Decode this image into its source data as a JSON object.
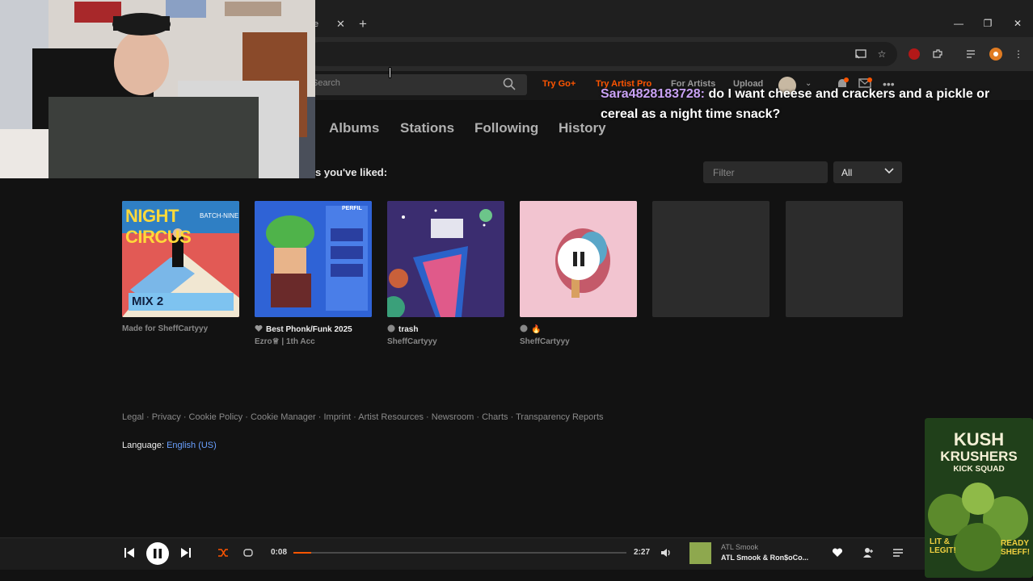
{
  "header": {
    "search_placeholder": "Search",
    "try_go": "Try Go+",
    "try_artist_pro": "Try Artist Pro",
    "for_artists": "For Artists",
    "upload": "Upload"
  },
  "chat": {
    "username": "Sara4828183728:",
    "message": " do I want cheese and crackers and a pickle or cereal as a night time snack?"
  },
  "library_tabs": [
    "Albums",
    "Stations",
    "Following",
    "History"
  ],
  "liked_heading": "s you've liked:",
  "filter": {
    "placeholder": "Filter",
    "select_value": "All"
  },
  "tiles": [
    {
      "art_text": "NIGHT CIRCUS",
      "art_sub": "BATCH-NINE",
      "art_label": "MIX 2",
      "title": "Made for SheffCartyyy",
      "subtitle": ""
    },
    {
      "art_text": "PERFIL",
      "title": "Best Phonk/Funk 2025",
      "subtitle": "Ezro♕ | 1th Acc"
    },
    {
      "title": "trash",
      "subtitle": "SheffCartyyy"
    },
    {
      "title": "🔥",
      "subtitle": "SheffCartyyy"
    }
  ],
  "footer": {
    "links": [
      "Legal",
      "Privacy",
      "Cookie Policy",
      "Cookie Manager",
      "Imprint",
      "Artist Resources",
      "Newsroom",
      "Charts",
      "Transparency Reports"
    ],
    "language_label": "Language:",
    "language_value": "English (US)"
  },
  "player": {
    "elapsed": "0:08",
    "duration": "2:27",
    "progress": 0.054,
    "artist": "ATL Smook",
    "title": "ATL Smook & Ron$oCo..."
  },
  "overlay_art": {
    "line1": "KUSH",
    "line2": "KRUSHERS",
    "line3": "KICK SQUAD",
    "tag_left": "LIT & LEGIT!",
    "tag_right": "READY SHEFF!"
  },
  "colors": {
    "accent": "#ff5500",
    "chat_user": "#c9a2f5",
    "link": "#6aa0ff",
    "background": "#121212"
  }
}
